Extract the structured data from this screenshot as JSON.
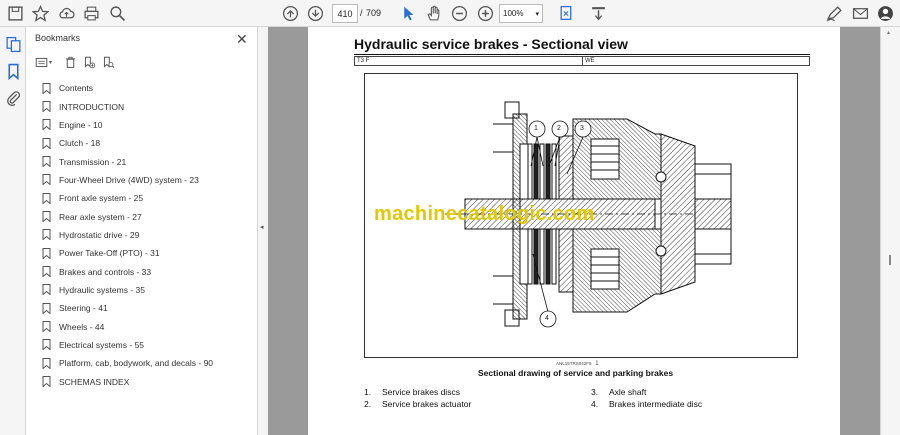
{
  "toolbar": {
    "page_current": "410",
    "page_separator": "/",
    "page_total": "709",
    "zoom": "100%"
  },
  "bookmarks": {
    "title": "Bookmarks",
    "items": [
      "Contents",
      "INTRODUCTION",
      "Engine - 10",
      "Clutch - 18",
      "Transmission - 21",
      "Four-Wheel Drive (4WD) system - 23",
      "Front axle system - 25",
      "Rear axle system - 27",
      "Hydrostatic drive - 29",
      "Power Take-Off (PTO) - 31",
      "Brakes and controls - 33",
      "Hydraulic systems - 35",
      "Steering - 41",
      "Wheels - 44",
      "Electrical systems - 55",
      "Platform, cab, bodywork, and decals - 90",
      "SCHEMAS INDEX"
    ]
  },
  "document": {
    "heading": "Hydraulic service brakes - Sectional view",
    "code_left": "T3 F",
    "code_right": "WE",
    "figure_code": "ANL15TRS042F8",
    "figure_number": "1",
    "caption": "Sectional drawing of service and parking brakes",
    "callouts": [
      "1",
      "2",
      "3",
      "4"
    ],
    "legend": [
      {
        "num": "1.",
        "text": "Service brakes discs"
      },
      {
        "num": "2.",
        "text": "Service brakes actuator"
      },
      {
        "num": "3.",
        "text": "Axle shaft"
      },
      {
        "num": "4.",
        "text": "Brakes intermediate disc"
      }
    ],
    "watermark": "machinecatalogic.com"
  }
}
